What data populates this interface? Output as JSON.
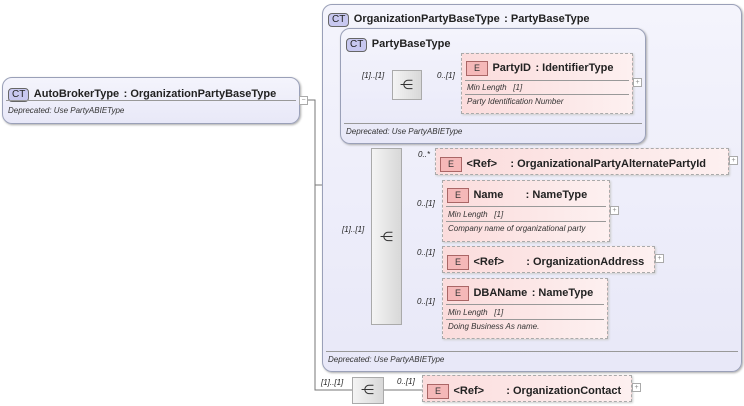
{
  "root": {
    "badge": "CT",
    "name": "AutoBrokerType",
    "type": ": OrganizationPartyBaseType",
    "note": "Deprecated: Use PartyABIEType",
    "toggle": "−"
  },
  "base": {
    "badge": "CT",
    "name": "OrganizationPartyBaseType",
    "type": ": PartyBaseType",
    "note": "Deprecated: Use PartyABIEType"
  },
  "party": {
    "badge": "CT",
    "name": "PartyBaseType",
    "note": "Deprecated: Use PartyABIEType",
    "seq_card": "[1]..[1]",
    "element": {
      "badge": "E",
      "name": "PartyID",
      "type": ": IdentifierType",
      "card": "0..[1]",
      "facet": "Min Length",
      "facet_val": "[1]",
      "doc": "Party Identification Number"
    }
  },
  "sequence": {
    "card": "[1]..[1]",
    "elements": [
      {
        "badge": "E",
        "name": "<Ref>",
        "type": ": OrganizationalPartyAlternatePartyId",
        "card": "0..*"
      },
      {
        "badge": "E",
        "name": "Name",
        "type": ": NameType",
        "card": "0..[1]",
        "facet": "Min Length",
        "facet_val": "[1]",
        "doc": "Company name of organizational party"
      },
      {
        "badge": "E",
        "name": "<Ref>",
        "type": ": OrganizationAddress",
        "card": "0..[1]"
      },
      {
        "badge": "E",
        "name": "DBAName",
        "type": ": NameType",
        "card": "0..[1]",
        "facet": "Min Length",
        "facet_val": "[1]",
        "doc": "Doing Business As name."
      }
    ]
  },
  "bottom": {
    "seq_card": "[1]..[1]",
    "badge": "E",
    "name": "<Ref>",
    "type": ": OrganizationContact",
    "card": "0..[1]"
  },
  "expand_symbol": "+"
}
